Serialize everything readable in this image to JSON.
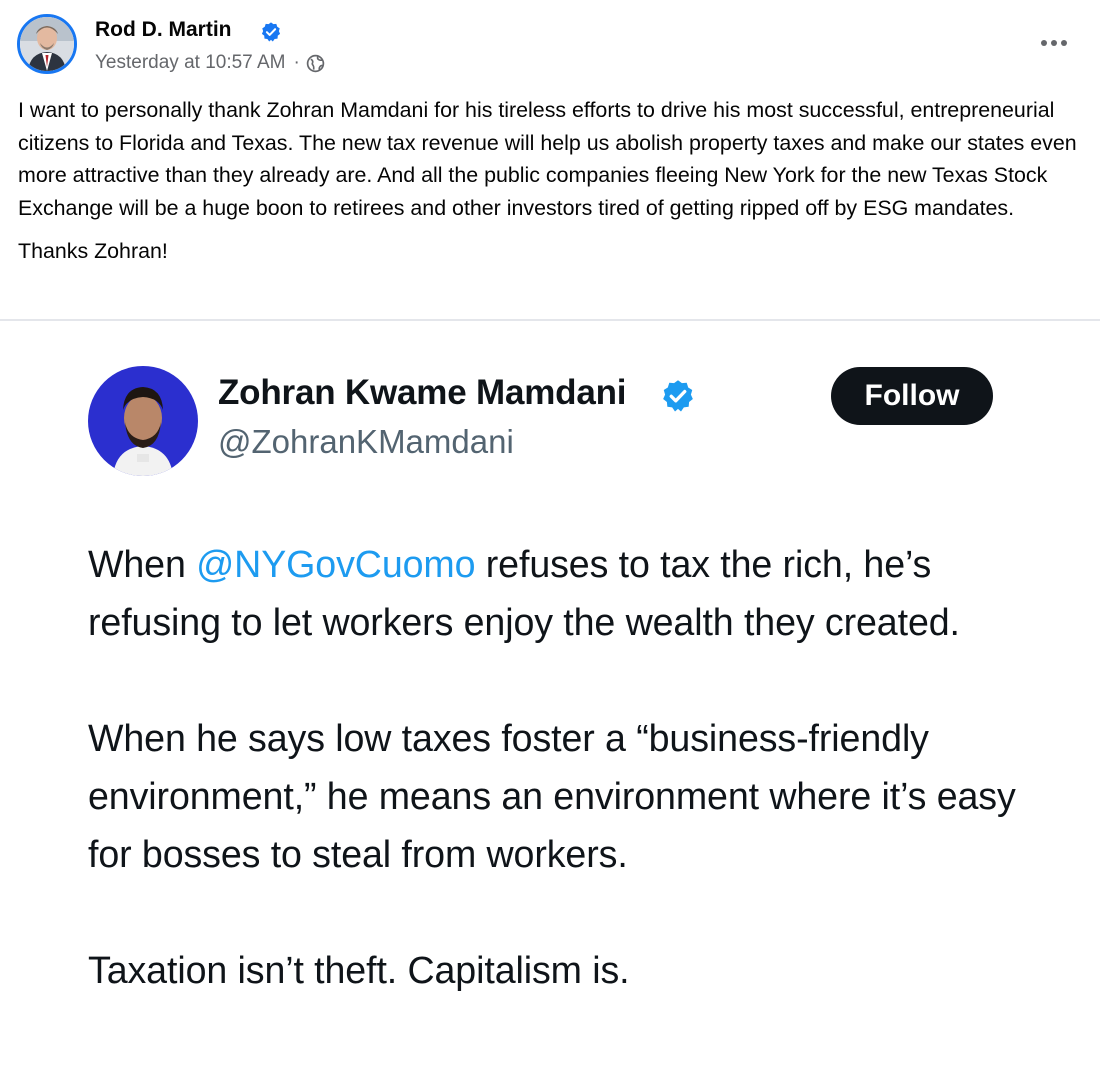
{
  "post": {
    "author_name": "Rod D. Martin",
    "timestamp": "Yesterday at 10:57 AM",
    "separator": "·",
    "privacy_icon": "globe-icon",
    "more_icon": "more-options-icon",
    "body_paragraph_1": "I want to personally thank Zohran Mamdani for his tireless efforts to drive his most successful, entrepreneurial citizens to Florida and Texas. The new tax revenue will help us abolish property taxes and make our states even more attractive than they already are. And all the public companies fleeing New York for the new Texas Stock Exchange will be a huge boon to retirees and other investors tired of getting ripped off by ESG mandates.",
    "body_paragraph_2": "Thanks Zohran!"
  },
  "embedded_tweet": {
    "display_name": "Zohran Kwame Mamdani",
    "handle": "@ZohranKMamdani",
    "follow_label": "Follow",
    "paragraph_1_before": "When ",
    "paragraph_1_mention": "@NYGovCuomo",
    "paragraph_1_after": " refuses to tax the rich, he’s refusing to let workers enjoy the wealth they created.",
    "paragraph_2": "When he says low taxes foster a “business-friendly environment,” he means an environment where it’s easy for bosses to steal from workers.",
    "paragraph_3": "Taxation isn’t theft. Capitalism is."
  },
  "colors": {
    "facebook_blue": "#1877f2",
    "twitter_blue": "#1d9bf0",
    "meta_gray": "#65676b",
    "follow_button_bg": "#0f1419",
    "tweet_avatar_bg": "#2b2fcf"
  }
}
